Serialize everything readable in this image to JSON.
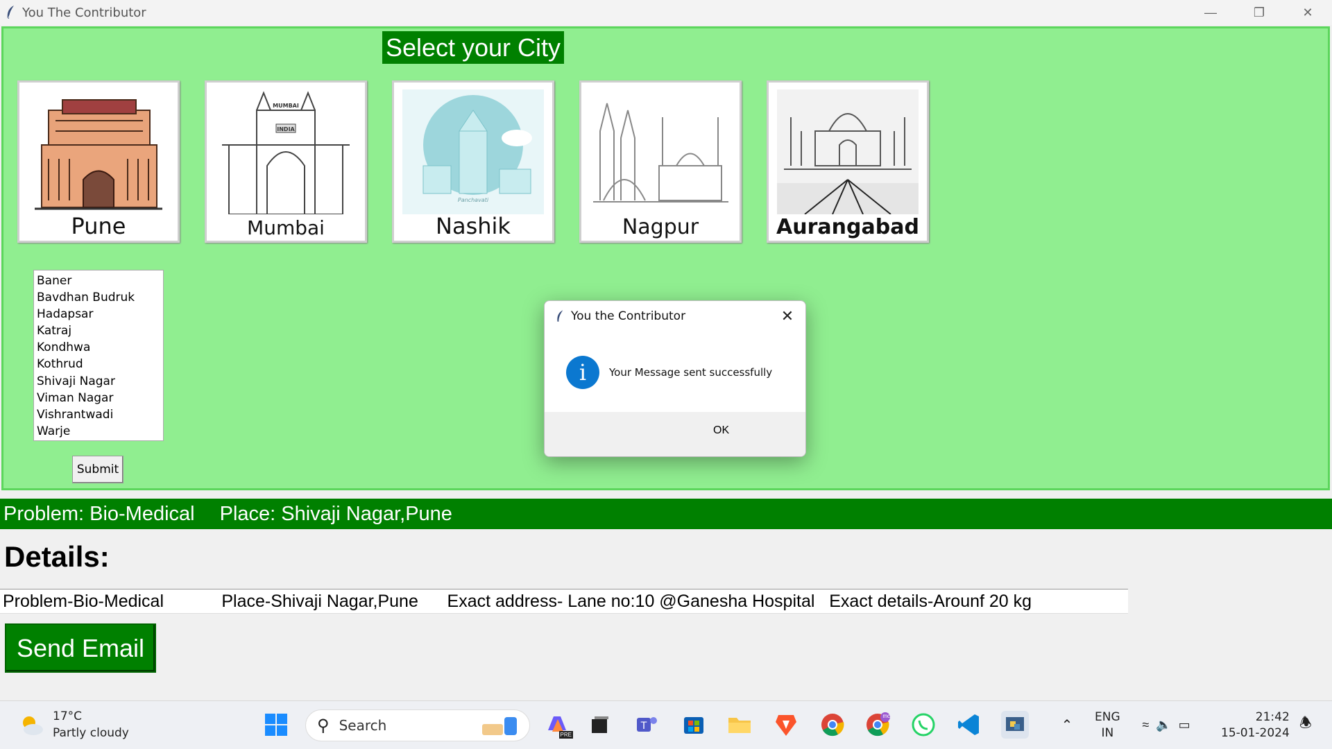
{
  "window": {
    "title": "You The Contributor"
  },
  "header": {
    "select_city": "Select your City"
  },
  "cities": [
    {
      "name": "Pune"
    },
    {
      "name": "Mumbai"
    },
    {
      "name": "Nashik"
    },
    {
      "name": "Nagpur"
    },
    {
      "name": "Aurangabad"
    }
  ],
  "city_art_text": {
    "mumbai_top": "MUMBAI",
    "mumbai_sign": "INDIA",
    "nashik_caption": "Panchavati"
  },
  "areas": [
    "Baner",
    "Bavdhan Budruk",
    "Hadapsar",
    "Katraj",
    "Kondhwa",
    "Kothrud",
    "Shivaji Nagar",
    "Viman Nagar",
    "Vishrantwadi",
    "Warje"
  ],
  "submit_label": "Submit",
  "problem_bar": {
    "problem": "Problem: Bio-Medical",
    "place": "Place: Shivaji Nagar,Pune"
  },
  "details": {
    "heading": "Details:",
    "value": "Problem-Bio-Medical            Place-Shivaji Nagar,Pune      Exact address- Lane no:10 @Ganesha Hospital   Exact details-Arounf 20 kg"
  },
  "send_email_label": "Send Email",
  "dialog": {
    "title": "You the Contributor",
    "message": "Your Message sent successfully",
    "ok_label": "OK"
  },
  "taskbar": {
    "weather_temp": "17°C",
    "weather_desc": "Partly cloudy",
    "search_placeholder": "Search",
    "lang": "ENG",
    "region": "IN",
    "time": "21:42",
    "date": "15-01-2024",
    "copilot_badge": "PRE",
    "chrome_profile_badge": "mc"
  },
  "colors": {
    "bg_green": "#90ee90",
    "dark_green": "#008000",
    "info_blue": "#0b78d0"
  }
}
